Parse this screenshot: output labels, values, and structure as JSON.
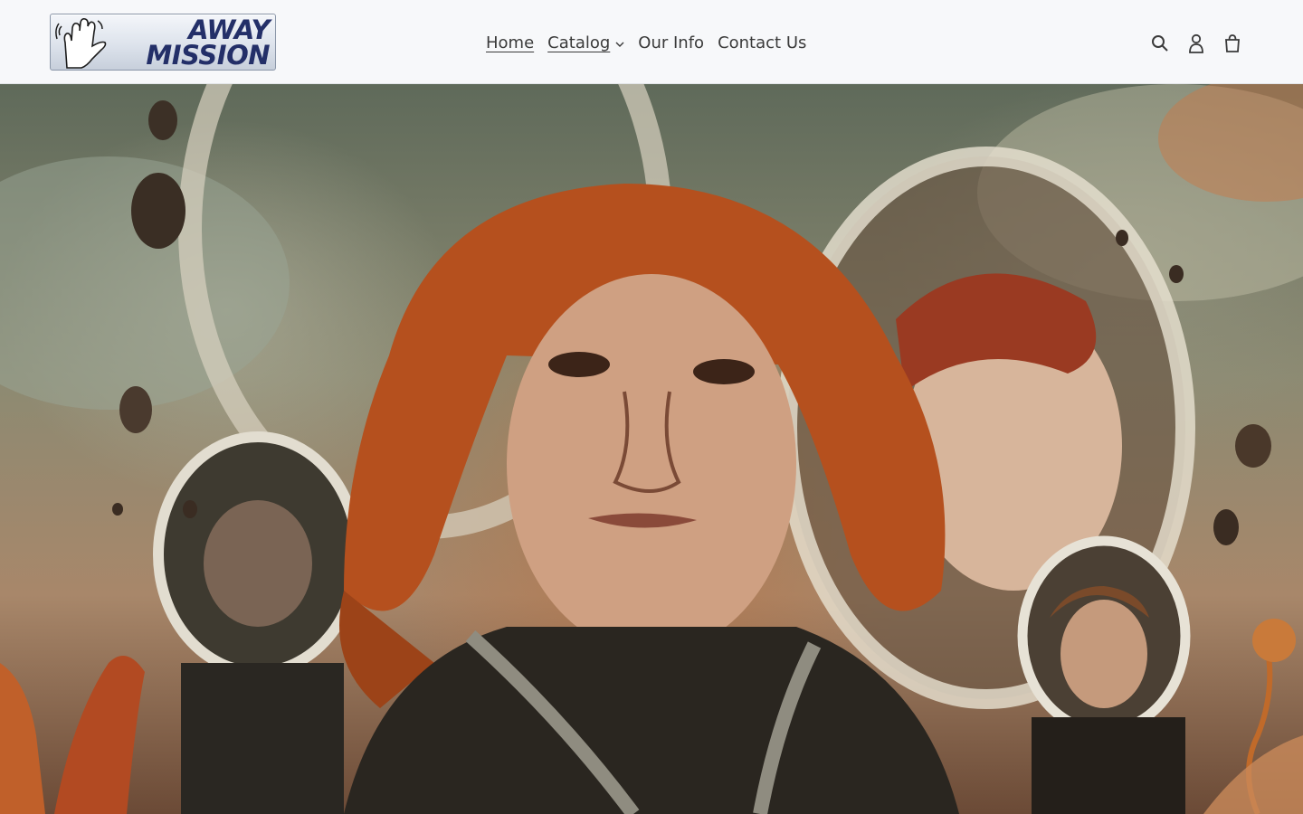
{
  "brand": {
    "logo_line1": "AWAY",
    "logo_line2": "MISSION",
    "logo_text_color": "#232f68"
  },
  "nav": {
    "items": [
      {
        "label": "Home",
        "active": true
      },
      {
        "label": "Catalog",
        "has_dropdown": true
      },
      {
        "label": "Our Info"
      },
      {
        "label": "Contact Us"
      }
    ]
  },
  "header_icons": [
    "search-icon",
    "account-icon",
    "cart-icon"
  ],
  "hero": {
    "description": "Retro sci-fi illustration of astronauts in bubble helmets"
  }
}
